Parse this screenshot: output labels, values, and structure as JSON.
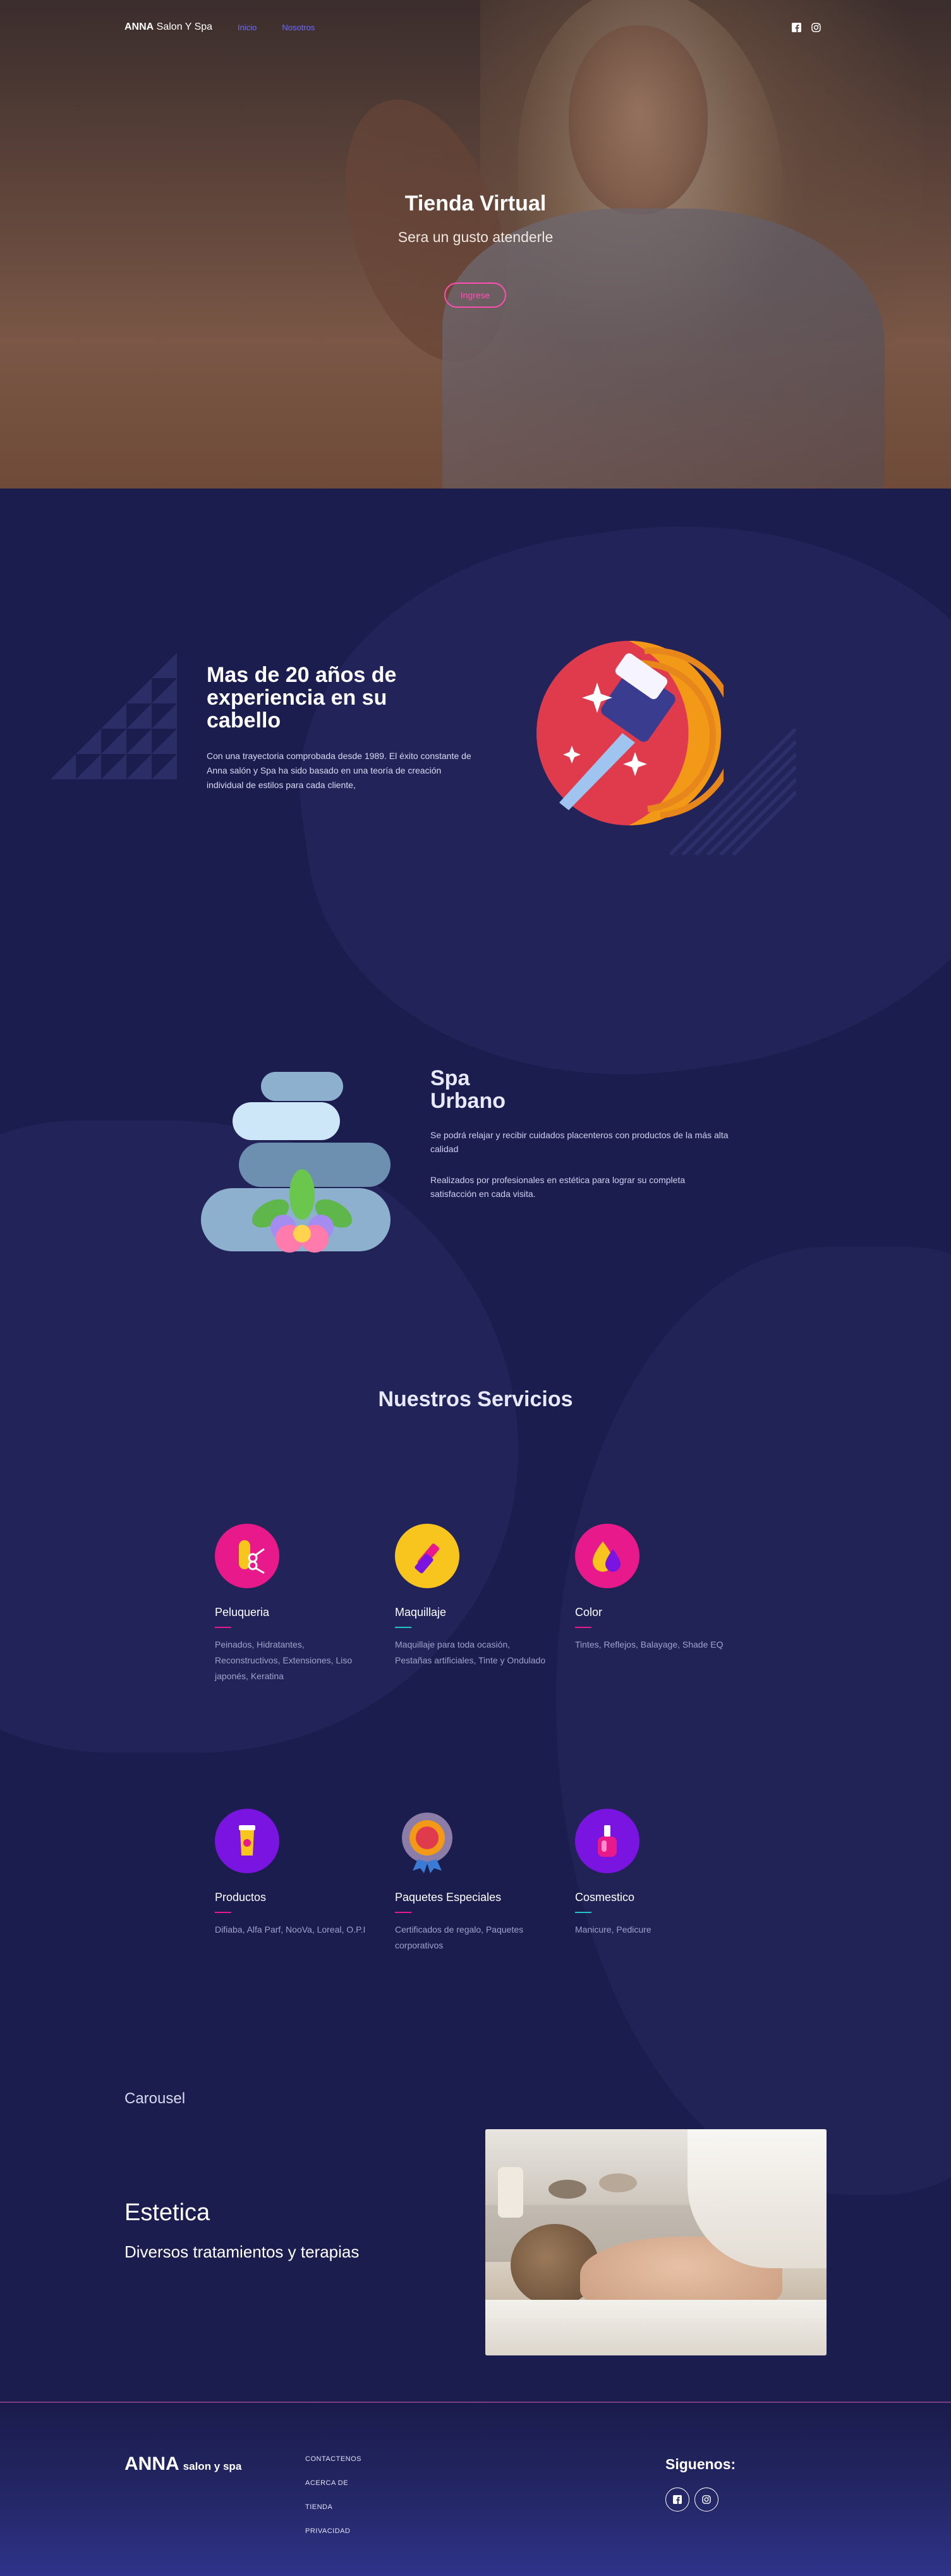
{
  "nav": {
    "brand_bold": "ANNA",
    "brand_rest": "Salon Y Spa",
    "links": [
      "Inicio",
      "Nosotros"
    ]
  },
  "hero": {
    "title": "Tienda Virtual",
    "subtitle": "Sera un gusto atenderle",
    "button": "Ingrese"
  },
  "experience": {
    "title": "Mas de 20 años de experiencia en su cabello",
    "text": "Con una trayectoria comprobada desde 1989. El éxito constante de Anna salón y Spa ha sido basado en una teoría de creación individual de estilos para cada cliente,"
  },
  "spa": {
    "title_line1": "Spa",
    "title_line2": "Urbano",
    "p1": "Se podrá relajar y recibir cuidados placenteros con productos de la más alta calidad",
    "p2": "Realizados por profesionales en estética para lograr su completa satisfacción en cada visita."
  },
  "services": {
    "title": "Nuestros Servicios",
    "items": [
      {
        "name": "Peluqueria",
        "desc": "Peinados, Hidratantes, Reconstructivos, Extensiones, Liso japonés, Keratina",
        "color": "#e8198b",
        "line": "#e8198b",
        "icon": "hair-scissors-icon"
      },
      {
        "name": "Maquillaje",
        "desc": "Maquillaje para toda ocasión, Pestañas artificiales, Tinte y Ondulado",
        "color": "#f7c51e",
        "line": "#22c3c9",
        "icon": "lipstick-icon"
      },
      {
        "name": "Color",
        "desc": "Tintes, Reflejos, Balayage, Shade EQ",
        "color": "#e8198b",
        "line": "#e8198b",
        "icon": "color-drop-icon"
      },
      {
        "name": "Productos",
        "desc": "Difiaba, Alfa Parf, NooVa, Loreal, O.P.I",
        "color": "#7a14e0",
        "line": "#e8198b",
        "icon": "product-tube-icon"
      },
      {
        "name": "Paquetes Especiales",
        "desc": "Certificados de regalo, Paquetes corporativos",
        "color": "#7b6d9c",
        "line": "#e8198b",
        "icon": "award-badge-icon"
      },
      {
        "name": "Cosmestico",
        "desc": "Manicure, Pedicure",
        "color": "#7a14e0",
        "line": "#22c3c9",
        "icon": "nail-polish-icon"
      }
    ]
  },
  "carousel": {
    "label": "Carousel",
    "title": "Estetica",
    "subtitle": "Diversos tratamientos y terapias"
  },
  "footer": {
    "brand_big": "ANNA",
    "brand_small": "salon y spa",
    "links": [
      "CONTACTENOS",
      "ACERCA DE",
      "TIENDA",
      "PRIVACIDAD"
    ],
    "follow": "Siguenos:"
  }
}
